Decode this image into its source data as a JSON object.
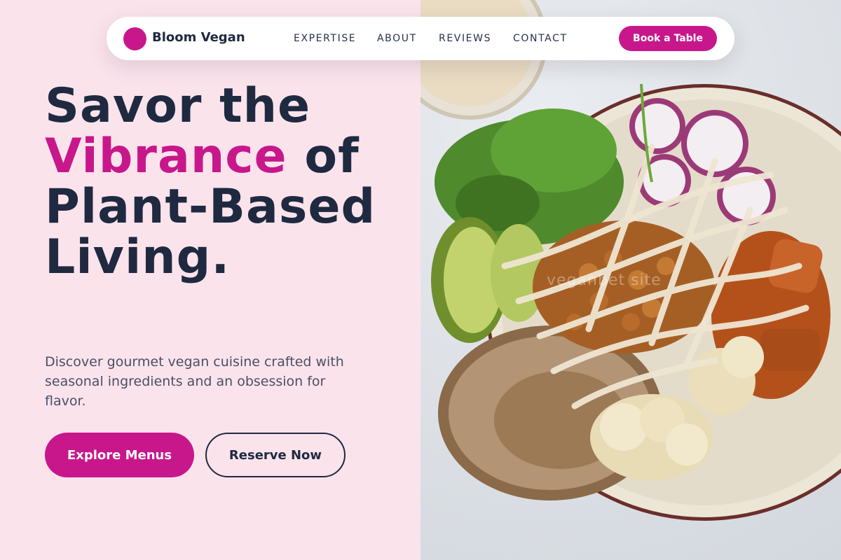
{
  "nav": {
    "brand": "Bloom Vegan",
    "links": [
      {
        "label": "EXPERTISE"
      },
      {
        "label": "ABOUT"
      },
      {
        "label": "REVIEWS"
      },
      {
        "label": "CONTACT"
      }
    ],
    "cta": "Book a Table"
  },
  "hero": {
    "title_line1": "Savor the",
    "title_accent": "Vibrance",
    "title_rest": " of Plant-Based Living.",
    "description": "Discover gourmet vegan cuisine crafted with seasonal ingredients and an obsession for flavor.",
    "primary_button": "Explore Menus",
    "secondary_button": "Reserve Now"
  },
  "image": {
    "watermark": "veganbet site"
  },
  "colors": {
    "accent": "#c8178b",
    "text_dark": "#1f2a40",
    "background_pink": "#fbe3ec"
  },
  "icons": {
    "logo": "pink-circle-logo-icon"
  }
}
